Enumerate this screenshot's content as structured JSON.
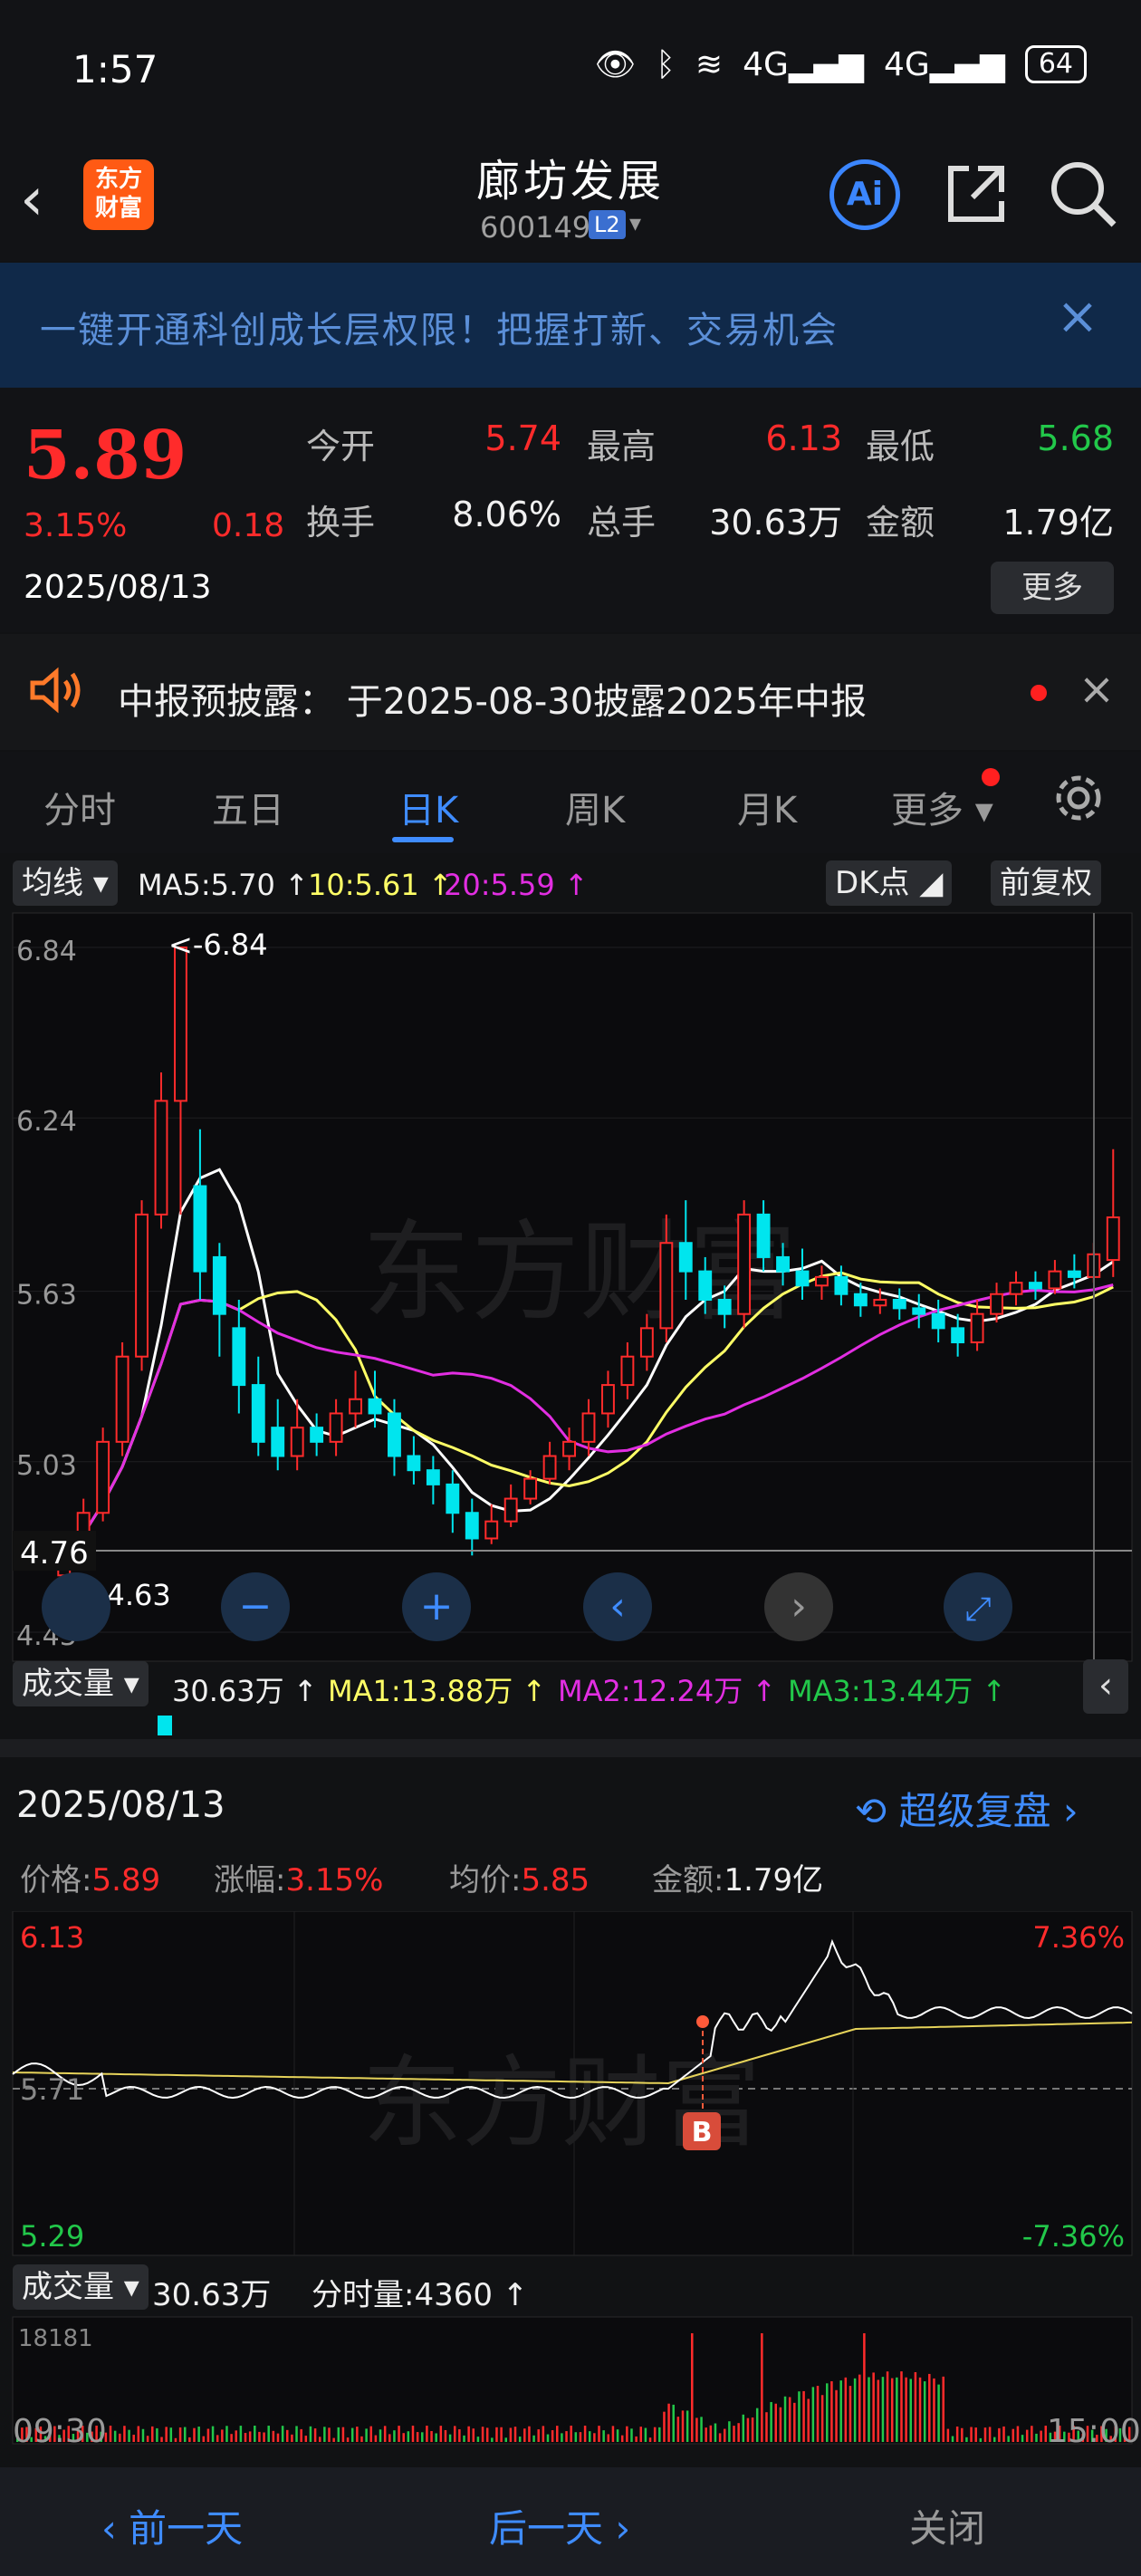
{
  "status_bar": {
    "time": "1:57",
    "network": "4G",
    "battery": "64"
  },
  "header": {
    "stock_name": "廊坊发展",
    "stock_code": "600149",
    "level_badge": "L2",
    "logo_line1": "东方",
    "logo_line2": "财富",
    "ai_label": "Ai"
  },
  "banner": {
    "text": "一键开通科创成长层权限！把握打新、交易机会",
    "close": "×"
  },
  "quote": {
    "price": "5.89",
    "change_pct": "3.15%",
    "change": "0.18",
    "date": "2025/08/13",
    "open_label": "今开",
    "open": "5.74",
    "high_label": "最高",
    "high": "6.13",
    "low_label": "最低",
    "low": "5.68",
    "turnover_label": "换手",
    "turnover": "8.06%",
    "total_hand_label": "总手",
    "total_hand": "30.63万",
    "amount_label": "金额",
    "amount": "1.79亿",
    "more_label": "更多"
  },
  "notice": {
    "text": "中报预披露：  于2025-08-30披露2025年中报"
  },
  "tabs": [
    {
      "label": "分时"
    },
    {
      "label": "五日"
    },
    {
      "label": "日K"
    },
    {
      "label": "周K"
    },
    {
      "label": "月K"
    },
    {
      "label": "更多"
    }
  ],
  "indicators": {
    "ma_selector": "均线",
    "ma5": "MA5:5.70 ↑",
    "ma10": "10:5.61 ↑",
    "ma20": "20:5.59 ↑",
    "dk_label": "DK点",
    "fq_label": "前复权"
  },
  "kchart": {
    "y_ticks": [
      "6.84",
      "6.24",
      "5.63",
      "5.03",
      "4.43"
    ],
    "max_label": "<-6.84",
    "min_label": "<---4.63",
    "crosshair_value": "4.76",
    "watermark": "东方财富"
  },
  "volume_row": {
    "selector": "成交量",
    "total": "30.63万 ↑",
    "ma1": "MA1:13.88万 ↑",
    "ma2": "MA2:12.24万 ↑",
    "ma3": "MA3:13.44万 ↑"
  },
  "intraday": {
    "date": "2025/08/13",
    "super_replay": "超级复盘",
    "price_label": "价格:",
    "price": "5.89",
    "pct_label": "涨幅:",
    "pct": "3.15%",
    "avg_label": "均价:",
    "avg": "5.85",
    "amount_label": "金额:",
    "amount": "1.79亿",
    "y_high": "6.13",
    "y_mid": "5.71",
    "y_low": "5.29",
    "pct_high": "7.36%",
    "pct_low": "-7.36%",
    "b_marker": "B",
    "vol_selector": "成交量",
    "vol_total": "30.63万",
    "vol_minute": "分时量:4360 ↑",
    "vol_max": "18181",
    "time_start": "09:30",
    "time_end": "15:00"
  },
  "bottom_bar": {
    "prev_day": "前一天",
    "next_day": "后一天",
    "close": "关闭"
  },
  "colors": {
    "up": "#ff2b2b",
    "down": "#00e5ee",
    "ma5": "#ffffff",
    "ma10": "#ffff66",
    "ma20": "#e22ee2",
    "accent": "#3f8cff"
  },
  "chart_data": {
    "type": "candlestick",
    "ylim": [
      4.43,
      6.84
    ],
    "candles": [
      [
        4.63,
        4.7,
        4.76,
        4.62
      ],
      [
        4.7,
        4.85,
        4.9,
        4.68
      ],
      [
        4.85,
        5.1,
        5.15,
        4.82
      ],
      [
        5.1,
        5.4,
        5.45,
        5.05
      ],
      [
        5.4,
        5.9,
        5.95,
        5.35
      ],
      [
        5.9,
        6.3,
        6.4,
        5.85
      ],
      [
        6.3,
        6.84,
        6.84,
        5.9
      ],
      [
        6.0,
        5.7,
        6.2,
        5.6
      ],
      [
        5.75,
        5.55,
        5.8,
        5.4
      ],
      [
        5.5,
        5.3,
        5.6,
        5.2
      ],
      [
        5.3,
        5.1,
        5.4,
        5.05
      ],
      [
        5.15,
        5.05,
        5.25,
        5.0
      ],
      [
        5.05,
        5.15,
        5.25,
        5.0
      ],
      [
        5.15,
        5.1,
        5.2,
        5.05
      ],
      [
        5.1,
        5.2,
        5.25,
        5.05
      ],
      [
        5.2,
        5.25,
        5.35,
        5.15
      ],
      [
        5.25,
        5.2,
        5.35,
        5.15
      ],
      [
        5.2,
        5.05,
        5.25,
        4.98
      ],
      [
        5.05,
        5.0,
        5.12,
        4.95
      ],
      [
        5.0,
        4.95,
        5.05,
        4.88
      ],
      [
        4.95,
        4.85,
        5.0,
        4.78
      ],
      [
        4.85,
        4.76,
        4.9,
        4.7
      ],
      [
        4.76,
        4.82,
        4.88,
        4.74
      ],
      [
        4.82,
        4.9,
        4.95,
        4.8
      ],
      [
        4.9,
        4.97,
        5.0,
        4.88
      ],
      [
        4.97,
        5.05,
        5.1,
        4.95
      ],
      [
        5.05,
        5.1,
        5.15,
        5.0
      ],
      [
        5.1,
        5.2,
        5.25,
        5.05
      ],
      [
        5.2,
        5.3,
        5.35,
        5.15
      ],
      [
        5.3,
        5.4,
        5.45,
        5.25
      ],
      [
        5.4,
        5.5,
        5.55,
        5.35
      ],
      [
        5.5,
        5.8,
        5.9,
        5.45
      ],
      [
        5.8,
        5.7,
        5.95,
        5.6
      ],
      [
        5.7,
        5.6,
        5.75,
        5.55
      ],
      [
        5.6,
        5.55,
        5.65,
        5.5
      ],
      [
        5.55,
        5.9,
        5.95,
        5.5
      ],
      [
        5.9,
        5.75,
        5.95,
        5.7
      ],
      [
        5.75,
        5.7,
        5.8,
        5.65
      ],
      [
        5.7,
        5.65,
        5.78,
        5.6
      ],
      [
        5.65,
        5.68,
        5.72,
        5.6
      ],
      [
        5.68,
        5.62,
        5.72,
        5.58
      ],
      [
        5.62,
        5.58,
        5.66,
        5.54
      ],
      [
        5.58,
        5.6,
        5.64,
        5.55
      ],
      [
        5.6,
        5.57,
        5.64,
        5.53
      ],
      [
        5.57,
        5.55,
        5.62,
        5.5
      ],
      [
        5.55,
        5.5,
        5.6,
        5.45
      ],
      [
        5.5,
        5.45,
        5.55,
        5.4
      ],
      [
        5.45,
        5.55,
        5.6,
        5.42
      ],
      [
        5.55,
        5.62,
        5.66,
        5.52
      ],
      [
        5.62,
        5.66,
        5.7,
        5.58
      ],
      [
        5.66,
        5.64,
        5.7,
        5.6
      ],
      [
        5.64,
        5.7,
        5.74,
        5.62
      ],
      [
        5.7,
        5.68,
        5.76,
        5.64
      ],
      [
        5.68,
        5.76,
        5.8,
        5.66
      ],
      [
        5.74,
        5.89,
        6.13,
        5.68
      ]
    ]
  }
}
